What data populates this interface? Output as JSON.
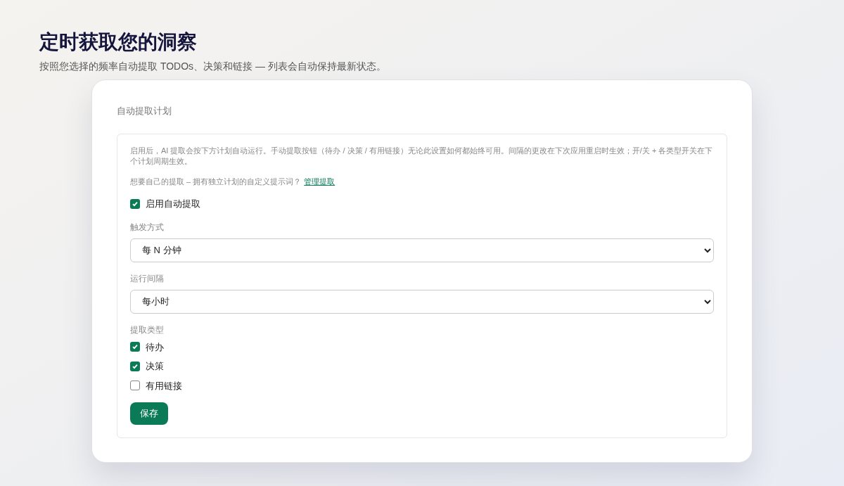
{
  "page": {
    "title": "定时获取您的洞察",
    "subtitle": "按照您选择的频率自动提取 TODOs、决策和链接 — 列表会自动保持最新状态。"
  },
  "card": {
    "heading": "自动提取计划",
    "description": "启用后，AI 提取会按下方计划自动运行。手动提取按钮（待办 / 决策 / 有用链接）无论此设置如何都始终可用。间隔的更改在下次应用重启时生效；开/关 + 各类型开关在下个计划周期生效。",
    "custom_prompt": {
      "text": "想要自己的提取 – 拥有独立计划的自定义提示词？",
      "link": "管理提取"
    },
    "enable": {
      "label": "启用自动提取",
      "checked": true
    },
    "trigger": {
      "label": "触发方式",
      "value": "每 N 分钟"
    },
    "interval": {
      "label": "运行间隔",
      "value": "每小时"
    },
    "types": {
      "label": "提取类型",
      "items": [
        {
          "label": "待办",
          "checked": true
        },
        {
          "label": "决策",
          "checked": true
        },
        {
          "label": "有用链接",
          "checked": false
        }
      ]
    },
    "save_button": "保存"
  }
}
